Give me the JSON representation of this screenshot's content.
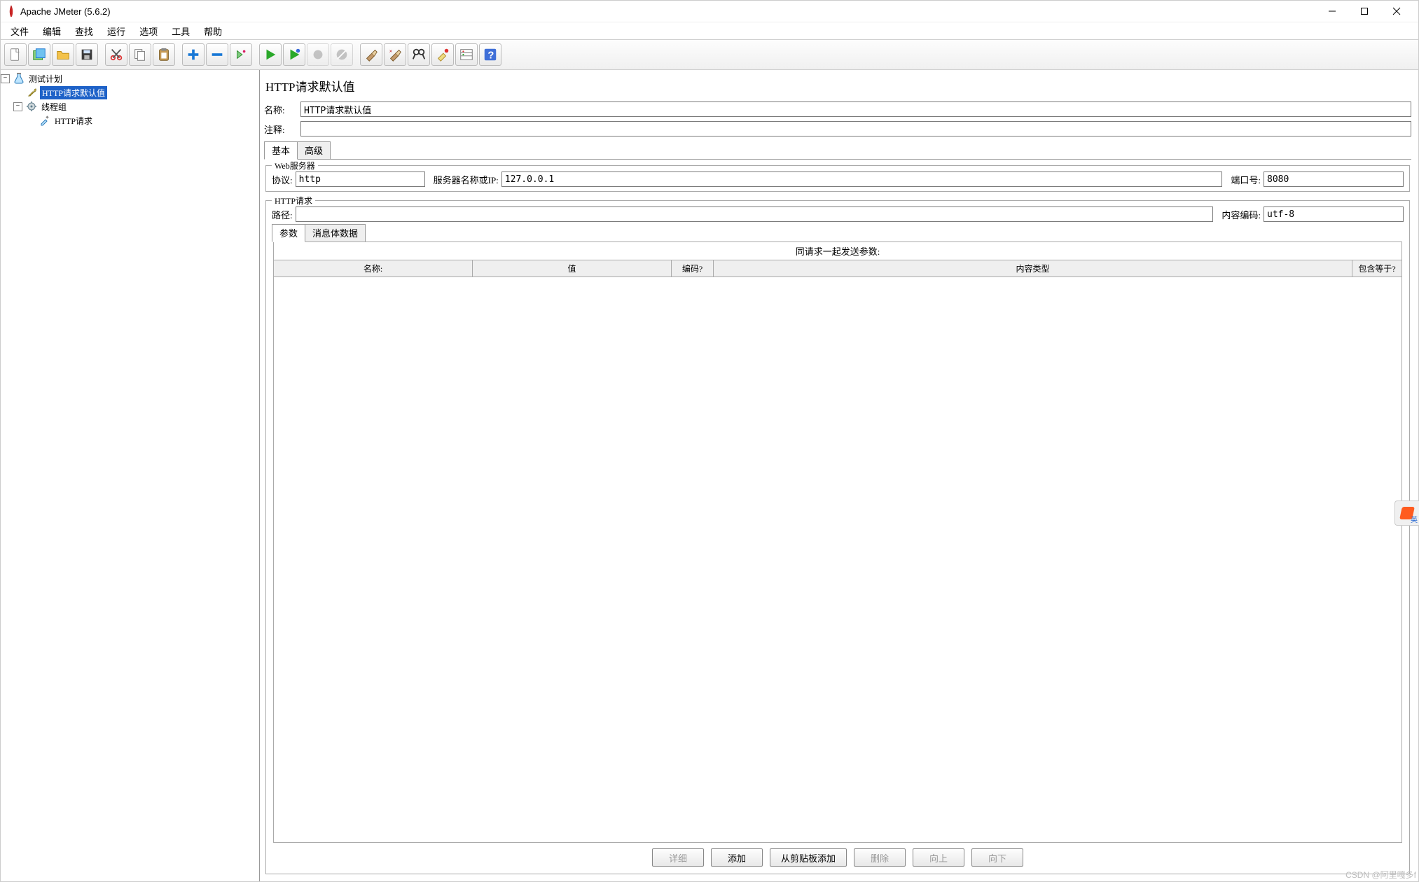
{
  "title": "Apache JMeter (5.6.2)",
  "menu": {
    "file": "文件",
    "edit": "编辑",
    "search": "查找",
    "run": "运行",
    "options": "选项",
    "tools": "工具",
    "help": "帮助"
  },
  "tree": {
    "root": "测试计划",
    "child1": "HTTP请求默认值",
    "child2": "线程组",
    "child2a": "HTTP请求"
  },
  "panel_title": "HTTP请求默认值",
  "labels": {
    "name": "名称:",
    "comment": "注释:",
    "tab_basic": "基本",
    "tab_adv": "高级",
    "fs_web": "Web服务器",
    "protocol": "协议:",
    "server": "服务器名称或IP:",
    "port": "端口号:",
    "fs_http": "HTTP请求",
    "path": "路径:",
    "encoding": "内容编码:",
    "subtab_params": "参数",
    "subtab_body": "消息体数据",
    "params_header": "同请求一起发送参数:",
    "th_name": "名称:",
    "th_value": "值",
    "th_encode": "编码?",
    "th_ctype": "内容类型",
    "th_equals": "包含等于?"
  },
  "values": {
    "name": "HTTP请求默认值",
    "comment": "",
    "protocol": "http",
    "server": "127.0.0.1",
    "port": "8080",
    "path": "",
    "encoding": "utf-8"
  },
  "buttons": {
    "detail": "详细",
    "add": "添加",
    "clip": "从剪贴板添加",
    "delete": "删除",
    "up": "向上",
    "down": "向下"
  },
  "watermark": "CSDN @阿里嘎多f",
  "ime_hint": "英"
}
